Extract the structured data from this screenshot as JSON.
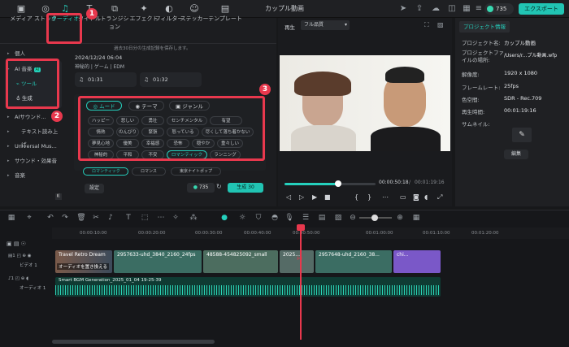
{
  "app": {
    "title": "カップル動画",
    "credits": "735",
    "export_label": "エクスポート"
  },
  "media_tabs": [
    {
      "label": "メディア",
      "icon": "media-icon"
    },
    {
      "label": "ストック",
      "icon": "stock-icon"
    },
    {
      "label": "オーディオ",
      "icon": "music-note-icon"
    },
    {
      "label": "タイトル",
      "icon": "title-icon"
    },
    {
      "label": "トランジション",
      "icon": "transition-icon"
    },
    {
      "label": "エフェクト",
      "icon": "effect-icon"
    },
    {
      "label": "フィルター",
      "icon": "filter-icon"
    },
    {
      "label": "ステッカー",
      "icon": "sticker-icon"
    },
    {
      "label": "テンプレート",
      "icon": "template-icon"
    }
  ],
  "sidebar": {
    "personal": "個人",
    "ai_music": "AI 音楽",
    "ai_badge": "AI",
    "tool": "ツール",
    "generate": "生成",
    "ai_sound": "AIサウンド...",
    "tts": "テキスト読み上げ",
    "universal": "Universal Mus...",
    "sound_effects": "サウンド・効果音",
    "music": "音楽"
  },
  "content": {
    "notice": "過去30日分の生成記録を保存します。",
    "date": "2024/12/24 06:04",
    "tags": "神秘的 | ゲーム | EDM",
    "track1": "01:31",
    "track2": "01:32",
    "mood_tabs": [
      "ムード",
      "テーマ",
      "ジャンル"
    ],
    "chips": [
      [
        "ハッピー",
        "悲しい",
        "勇壮",
        "センチメンタル",
        "有望"
      ],
      [
        "情熱",
        "のんびり",
        "緊張",
        "怒っている",
        "尽くして落ち着かない"
      ],
      [
        "夢見心地",
        "優美",
        "幸福感",
        "恐怖",
        "穏やか",
        "重々しい"
      ],
      [
        "神秘的",
        "平和",
        "不安",
        "ロマンティック",
        "ランニング"
      ]
    ],
    "selected": [
      "ロマンティック",
      "ロマンス",
      "東京ナイトポップ"
    ],
    "settings": "設定",
    "cost": "735",
    "generate": "生成",
    "generate_cost": "30"
  },
  "callouts": [
    "1",
    "2",
    "3"
  ],
  "preview": {
    "tab_label": "再生",
    "quality": "フル品質",
    "time_current": "00:00:50:18",
    "time_total": "00:01:19:16"
  },
  "properties": {
    "tab": "プロジェクト情報",
    "rows": [
      {
        "label": "プロジェクト名:",
        "value": "カップル動画"
      },
      {
        "label": "プロジェクトファイルの場所:",
        "value": "/Users/r...プル動画.wfp"
      },
      {
        "label": "解像度:",
        "value": "1920 x 1080"
      },
      {
        "label": "フレームレート:",
        "value": "25fps"
      },
      {
        "label": "色空間:",
        "value": "SDR - Rec.709"
      },
      {
        "label": "再生時間:",
        "value": "00:01:19:16"
      },
      {
        "label": "サムネイル:",
        "value": ""
      }
    ],
    "edit": "編集"
  },
  "timeline": {
    "ticks": [
      "00:00:10:00",
      "00:00:20:00",
      "00:00:30:00",
      "00:00:40:00",
      "00:00:50:00",
      "00:01:00:00",
      "00:01:10:00",
      "00:01:20:00"
    ],
    "video_track": "ビデオ 1",
    "audio_track": "オーディオ 1",
    "clips": [
      "Travel Retro Dream",
      "2957633-uhd_3840_2160_24fps",
      "48588-454825092_small",
      "2025...",
      "2957648-uhd_2160_38...",
      "chi..."
    ],
    "hint": "オーディオを置き換える",
    "audio_clip": "Smart BGM Generation_2025_01_04 19-25-39"
  }
}
